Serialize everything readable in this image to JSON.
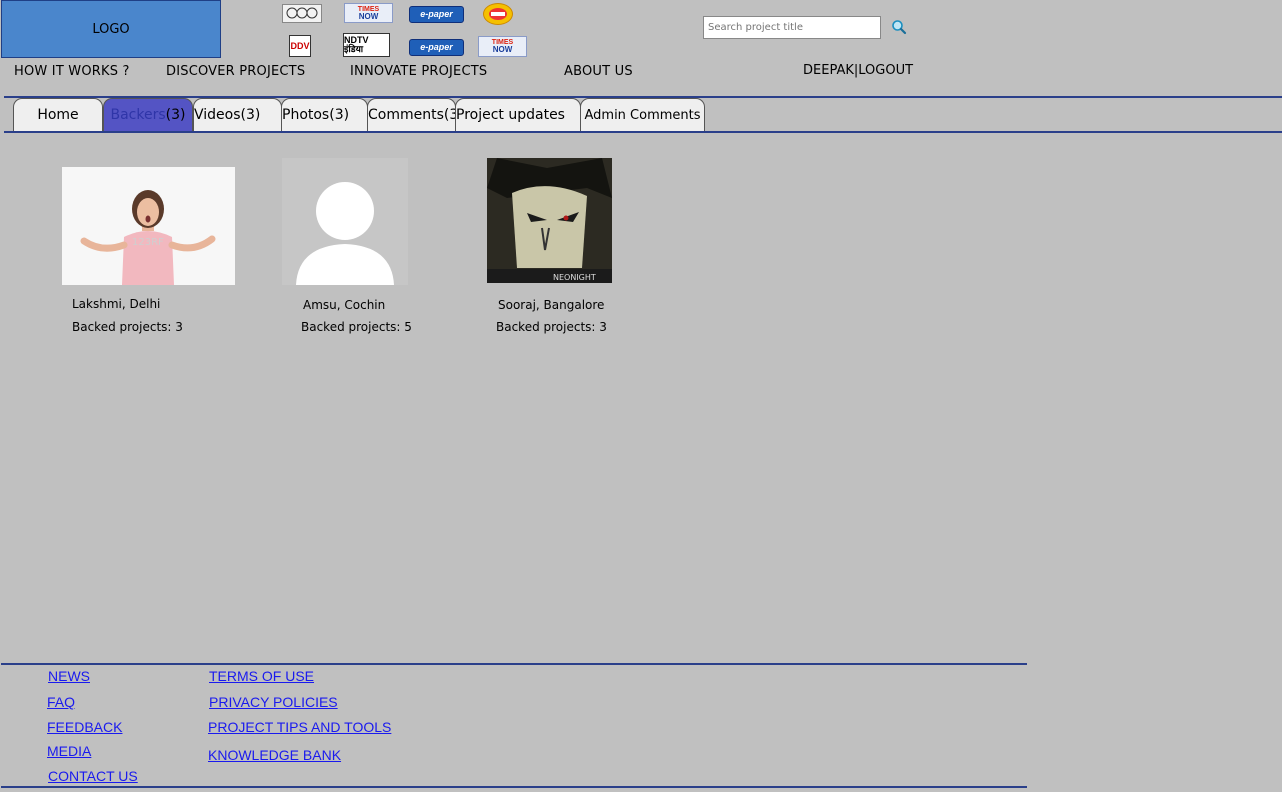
{
  "header": {
    "logo_text": "LOGO",
    "partners": [
      {
        "icon": "emblem-logo-icon"
      },
      {
        "icon": "times-now-logo-icon",
        "text_top": "TIMES",
        "text_bottom": "NOW"
      },
      {
        "icon": "epaper-logo-icon",
        "text": "e-paper"
      },
      {
        "icon": "badge-logo-icon"
      },
      {
        "icon": "ddv-logo-icon",
        "text": "DDV"
      },
      {
        "icon": "ndtv-india-logo-icon",
        "text": "NDTV इंडिया"
      },
      {
        "icon": "epaper-logo-icon",
        "text": "e-paper"
      },
      {
        "icon": "times-now-logo-icon",
        "text_top": "TIMES",
        "text_bottom": "NOW"
      }
    ],
    "search": {
      "placeholder": "Search project title"
    }
  },
  "nav": {
    "items": [
      "HOW IT WORKS ?",
      "DISCOVER PROJECTS",
      "INNOVATE PROJECTS",
      "ABOUT US"
    ],
    "user": "DEEPAK",
    "separator": "|",
    "logout": "LOGOUT"
  },
  "tabs": {
    "home": "Home",
    "backers_word": "Backers",
    "backers_count": "(3)",
    "videos": "Videos(3)",
    "photos": "Photos(3)",
    "comments": "Comments(3",
    "updates": "Project updates",
    "admin": "Admin Comments",
    "active": "backers",
    "active_color": "#5454c4"
  },
  "backers": [
    {
      "name": "Lakshmi, Delhi",
      "backed": "Backed projects: 3",
      "image": "woman-photo"
    },
    {
      "name": "Amsu, Cochin",
      "backed": "Backed projects:  5",
      "image": "default-avatar"
    },
    {
      "name": "Sooraj, Bangalore",
      "backed": "Backed projects: 3",
      "image": "anime-avatar",
      "avatar_caption": "NEONIGHT"
    }
  ],
  "footer": {
    "left": [
      "NEWS",
      "FAQ",
      "FEEDBACK",
      "MEDIA",
      "CONTACT US"
    ],
    "right": [
      "TERMS OF USE",
      "PRIVACY POLICIES",
      "PROJECT TIPS AND TOOLS",
      "KNOWLEDGE BANK"
    ],
    "link_color": "#1a1aee"
  }
}
